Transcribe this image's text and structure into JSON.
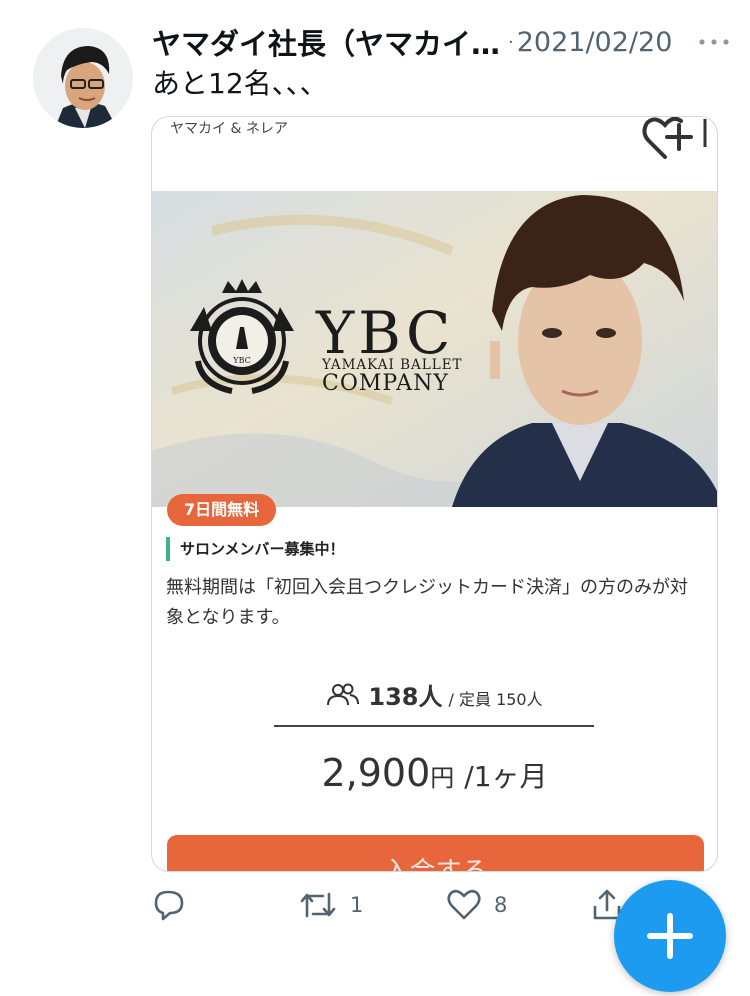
{
  "tweet": {
    "author_name": "ヤマダイ社長（ヤマカイ…",
    "separator": "·",
    "date": "2021/02/20",
    "text": "あと12名、、、"
  },
  "card": {
    "source": "ヤマカイ & ネレア",
    "banner": {
      "brand_mark": "YBC",
      "brand_line1": "YAMAKAI BALLET",
      "brand_line2": "COMPANY",
      "crest_text": "YBC"
    },
    "badge": "7日間無料",
    "heading": "サロンメンバー募集中！",
    "notice": "無料期間は「初回入会且つクレジットカード決済」の方のみが対象となります。",
    "member_count": "138人",
    "capacity": "/ 定員 150人",
    "price_amount": "2,900",
    "price_unit": "円",
    "price_period": "/1ヶ月",
    "join_button": "入会する"
  },
  "actions": {
    "reply_icon": "reply-icon",
    "retweet_icon": "retweet-icon",
    "retweet_count": "1",
    "like_icon": "heart-icon",
    "like_count": "8",
    "share_icon": "share-icon"
  },
  "fab_icon": "plus-icon",
  "colors": {
    "accent_orange": "#e8663c",
    "twitter_blue": "#1d9bf0",
    "heading_bar": "#3fb48a",
    "muted_text": "#536471"
  }
}
